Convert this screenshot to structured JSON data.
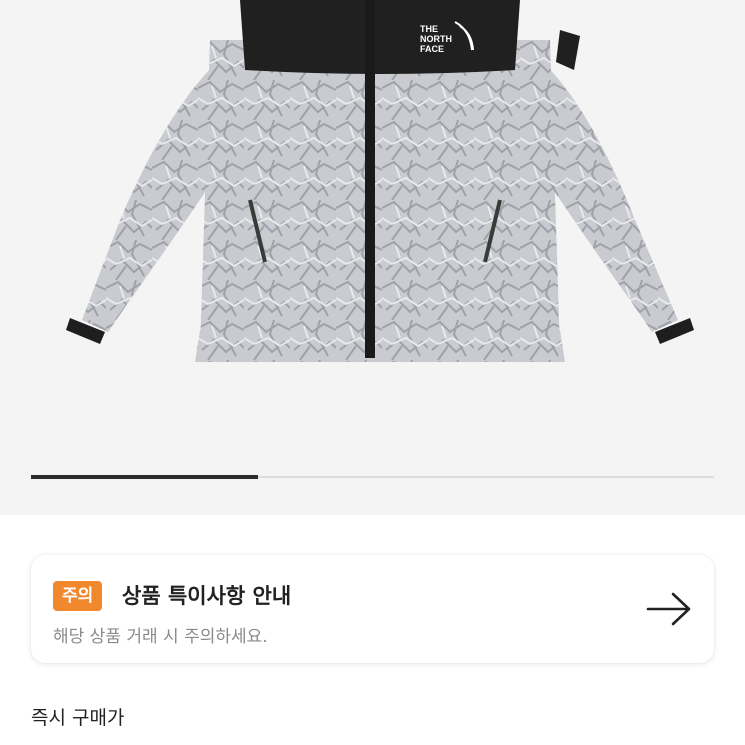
{
  "gallery": {
    "product": "jacket-photo",
    "brand_logo_line1": "THE",
    "brand_logo_line2": "NORTH",
    "brand_logo_line3": "FACE",
    "slide_progress": 0.333
  },
  "notice": {
    "badge": "주의",
    "title": "상품 특이사항 안내",
    "subtitle": "해당 상품 거래 시 주의하세요.",
    "icon": "arrow-right-icon",
    "badge_color": "#f2882e"
  },
  "price": {
    "label": "즉시 구매가"
  }
}
